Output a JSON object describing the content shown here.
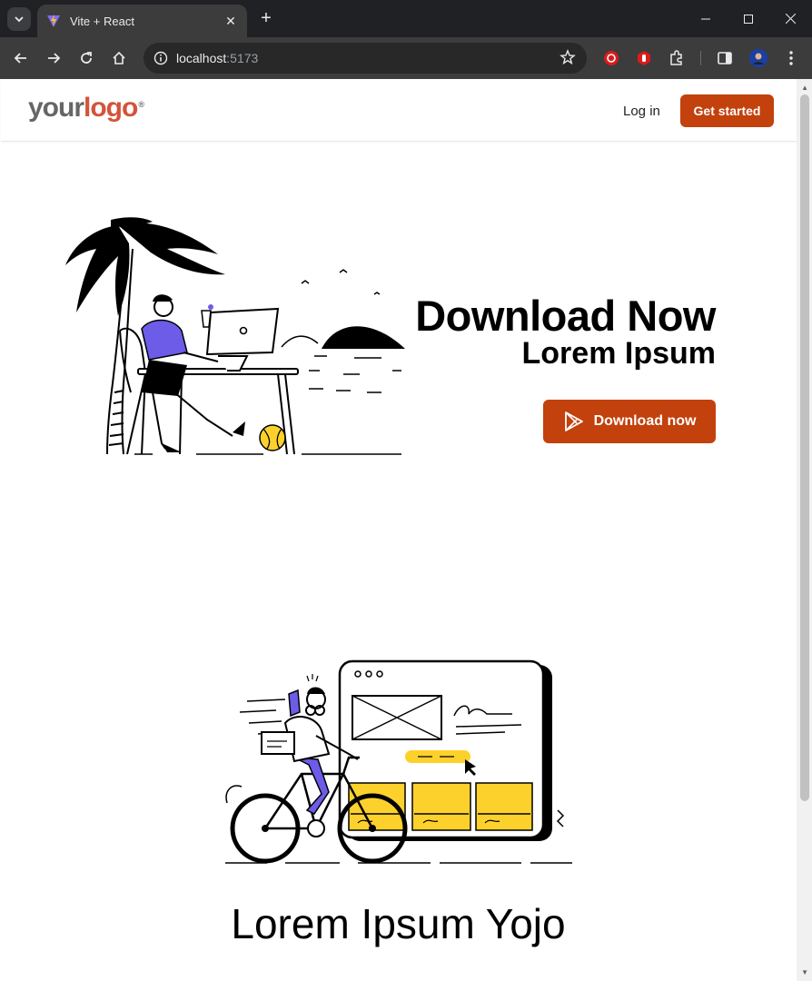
{
  "browser": {
    "tab_title": "Vite + React",
    "url_host": "localhost",
    "url_port": ":5173"
  },
  "navbar": {
    "logo_your": "your",
    "logo_logo": "logo",
    "logo_reg": "®",
    "login_label": "Log in",
    "cta_label": "Get started"
  },
  "hero": {
    "title": "Download Now",
    "subtitle": "Lorem Ipsum",
    "download_label": "Download now"
  },
  "section2": {
    "title": "Lorem Ipsum Yojo"
  },
  "colors": {
    "accent": "#c2410c",
    "logo_accent": "#d3543a",
    "illustration_purple": "#6c5ce7",
    "illustration_yellow": "#fdd12c"
  }
}
